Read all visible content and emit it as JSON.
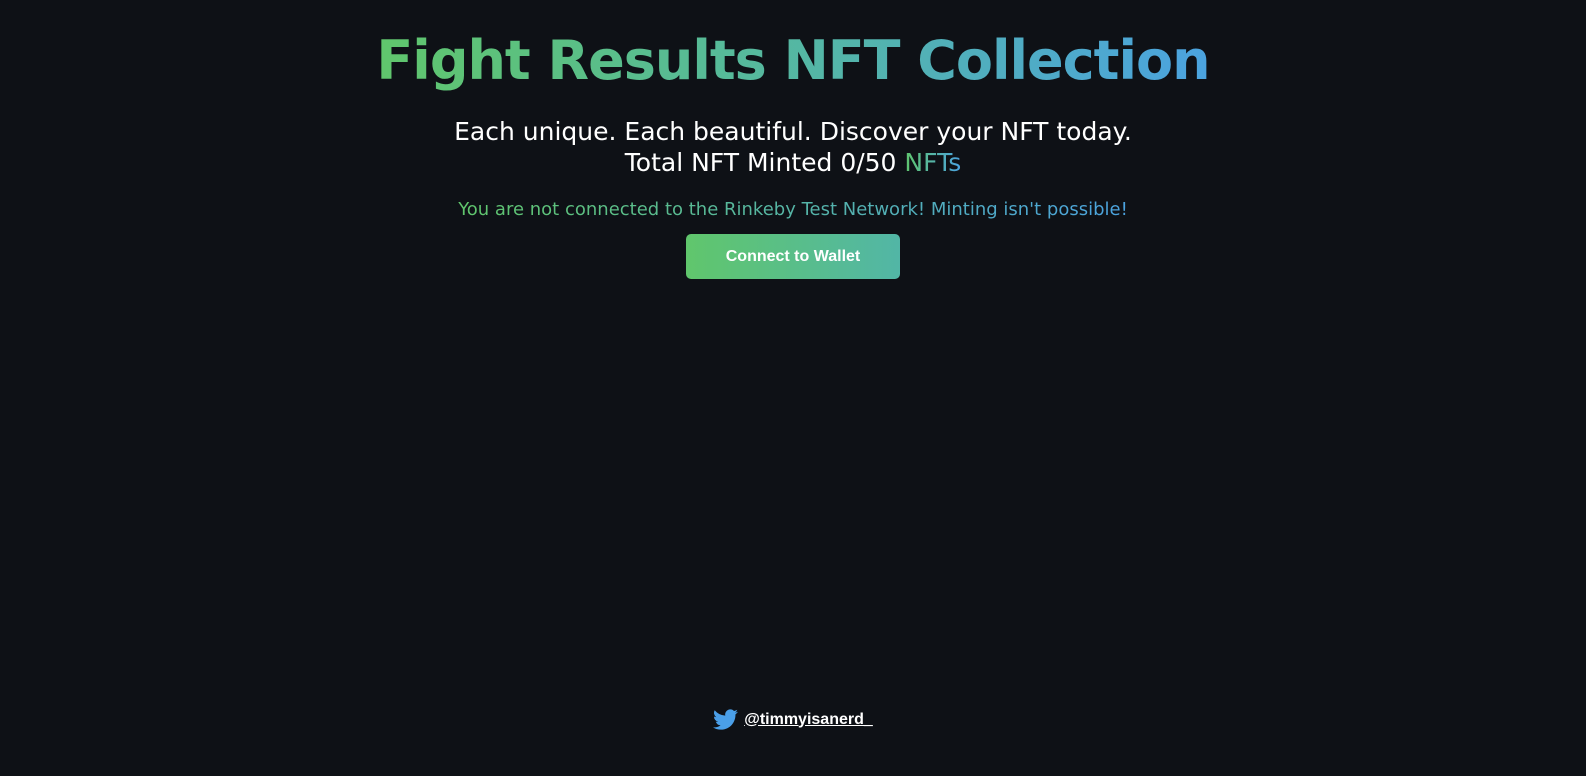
{
  "header": {
    "title": "Fight Results NFT Collection",
    "tagline": "Each unique. Each beautiful. Discover your NFT today.",
    "minted_prefix": "Total NFT Minted 0/50",
    "minted_suffix": "NFTs"
  },
  "status": {
    "network_warning": "You are not connected to the Rinkeby Test Network! Minting isn't possible!"
  },
  "actions": {
    "connect_label": "Connect to Wallet"
  },
  "footer": {
    "icon": "twitter-icon",
    "handle": "@timmyisanerd_"
  },
  "colors": {
    "background": "#0e1116",
    "gradient_start": "#60c66c",
    "gradient_end": "#4ba3e0",
    "twitter_blue": "#4a9fe8"
  }
}
